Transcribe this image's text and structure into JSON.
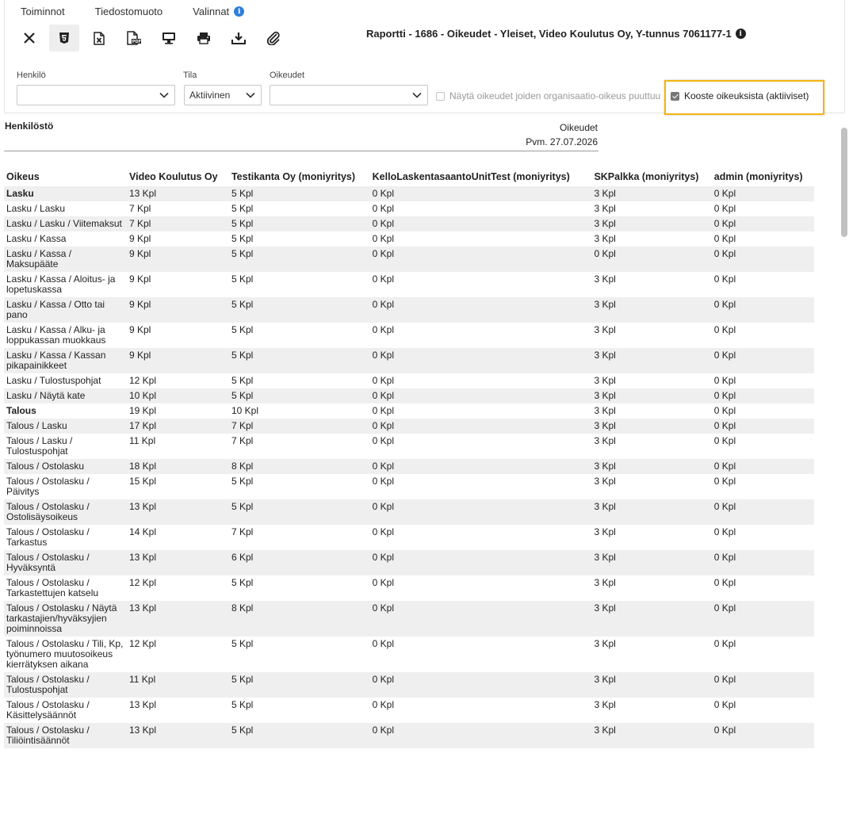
{
  "menu": {
    "items": [
      "Toiminnot",
      "Tiedostomuoto",
      "Valinnat"
    ]
  },
  "toolbar": {
    "buttons": [
      "close-icon",
      "html5-icon",
      "excel-icon",
      "pdf-icon",
      "screen-icon",
      "print-icon",
      "download-icon",
      "attachment-icon"
    ]
  },
  "report": {
    "title": "Raportti - 1686 - Oikeudet - Yleiset, Video Koulutus Oy, Y-tunnus 7061177-1",
    "section": "Henkilöstö",
    "kind": "Oikeudet",
    "date": "Pvm. 27.07.2026"
  },
  "filters": {
    "person_label": "Henkilö",
    "person_value": "",
    "status_label": "Tila",
    "status_value": "Aktiivinen",
    "rights_label": "Oikeudet",
    "rights_value": "",
    "show_org_label": "Näytä oikeudet joiden organisaatio-oikeus puuttuu",
    "show_org_checked": false,
    "summary_label": "Kooste oikeuksista (aktiiviset)",
    "summary_checked": true
  },
  "colors": {
    "highlight": "#f3b50f",
    "info": "#2f7fd8",
    "stripe": "#efefef"
  },
  "table": {
    "headers": [
      "Oikeus",
      "Video Koulutus Oy",
      "Testikanta Oy (moniyritys)",
      "KelloLaskentasaantoUnitTest (moniyritys)",
      "SKPalkka (moniyritys)",
      "admin (moniyritys)"
    ],
    "rows": [
      {
        "bold": true,
        "cells": [
          "Lasku",
          "13 Kpl",
          "5 Kpl",
          "0 Kpl",
          "3 Kpl",
          "0 Kpl"
        ]
      },
      {
        "bold": false,
        "cells": [
          "Lasku / Lasku",
          "7 Kpl",
          "5 Kpl",
          "0 Kpl",
          "3 Kpl",
          "0 Kpl"
        ]
      },
      {
        "bold": false,
        "cells": [
          "Lasku / Lasku / Viitemaksut",
          "7 Kpl",
          "5 Kpl",
          "0 Kpl",
          "3 Kpl",
          "0 Kpl"
        ]
      },
      {
        "bold": false,
        "cells": [
          "Lasku / Kassa",
          "9 Kpl",
          "5 Kpl",
          "0 Kpl",
          "3 Kpl",
          "0 Kpl"
        ]
      },
      {
        "bold": false,
        "cells": [
          "Lasku / Kassa / Maksupääte",
          "9 Kpl",
          "5 Kpl",
          "0 Kpl",
          "0 Kpl",
          "0 Kpl"
        ]
      },
      {
        "bold": false,
        "cells": [
          "Lasku / Kassa / Aloitus- ja lopetuskassa",
          "9 Kpl",
          "5 Kpl",
          "0 Kpl",
          "3 Kpl",
          "0 Kpl"
        ]
      },
      {
        "bold": false,
        "cells": [
          "Lasku / Kassa / Otto tai pano",
          "9 Kpl",
          "5 Kpl",
          "0 Kpl",
          "3 Kpl",
          "0 Kpl"
        ]
      },
      {
        "bold": false,
        "cells": [
          "Lasku / Kassa / Alku- ja loppukassan muokkaus",
          "9 Kpl",
          "5 Kpl",
          "0 Kpl",
          "3 Kpl",
          "0 Kpl"
        ]
      },
      {
        "bold": false,
        "cells": [
          "Lasku / Kassa / Kassan pikapainikkeet",
          "9 Kpl",
          "5 Kpl",
          "0 Kpl",
          "3 Kpl",
          "0 Kpl"
        ]
      },
      {
        "bold": false,
        "cells": [
          "Lasku / Tulostuspohjat",
          "12 Kpl",
          "5 Kpl",
          "0 Kpl",
          "3 Kpl",
          "0 Kpl"
        ]
      },
      {
        "bold": false,
        "cells": [
          "Lasku / Näytä kate",
          "10 Kpl",
          "5 Kpl",
          "0 Kpl",
          "3 Kpl",
          "0 Kpl"
        ]
      },
      {
        "bold": true,
        "cells": [
          "Talous",
          "19 Kpl",
          "10 Kpl",
          "0 Kpl",
          "3 Kpl",
          "0 Kpl"
        ]
      },
      {
        "bold": false,
        "cells": [
          "Talous / Lasku",
          "17 Kpl",
          "7 Kpl",
          "0 Kpl",
          "3 Kpl",
          "0 Kpl"
        ]
      },
      {
        "bold": false,
        "cells": [
          "Talous / Lasku / Tulostuspohjat",
          "11 Kpl",
          "7 Kpl",
          "0 Kpl",
          "3 Kpl",
          "0 Kpl"
        ]
      },
      {
        "bold": false,
        "cells": [
          "Talous / Ostolasku",
          "18 Kpl",
          "8 Kpl",
          "0 Kpl",
          "3 Kpl",
          "0 Kpl"
        ]
      },
      {
        "bold": false,
        "cells": [
          "Talous / Ostolasku / Päivitys",
          "15 Kpl",
          "5 Kpl",
          "0 Kpl",
          "3 Kpl",
          "0 Kpl"
        ]
      },
      {
        "bold": false,
        "cells": [
          "Talous / Ostolasku / Ostolisäysoikeus",
          "13 Kpl",
          "5 Kpl",
          "0 Kpl",
          "3 Kpl",
          "0 Kpl"
        ]
      },
      {
        "bold": false,
        "cells": [
          "Talous / Ostolasku / Tarkastus",
          "14 Kpl",
          "7 Kpl",
          "0 Kpl",
          "3 Kpl",
          "0 Kpl"
        ]
      },
      {
        "bold": false,
        "cells": [
          "Talous / Ostolasku / Hyväksyntä",
          "13 Kpl",
          "6 Kpl",
          "0 Kpl",
          "3 Kpl",
          "0 Kpl"
        ]
      },
      {
        "bold": false,
        "cells": [
          "Talous / Ostolasku / Tarkastettujen katselu",
          "12 Kpl",
          "5 Kpl",
          "0 Kpl",
          "3 Kpl",
          "0 Kpl"
        ]
      },
      {
        "bold": false,
        "cells": [
          "Talous / Ostolasku / Näytä tarkastajien/hyväksyjien poiminnoissa",
          "13 Kpl",
          "8 Kpl",
          "0 Kpl",
          "3 Kpl",
          "0 Kpl"
        ]
      },
      {
        "bold": false,
        "cells": [
          "Talous / Ostolasku / Tili, Kp, työnumero muutosoikeus kierrätyksen aikana",
          "12 Kpl",
          "5 Kpl",
          "0 Kpl",
          "3 Kpl",
          "0 Kpl"
        ]
      },
      {
        "bold": false,
        "cells": [
          "Talous / Ostolasku / Tulostuspohjat",
          "11 Kpl",
          "5 Kpl",
          "0 Kpl",
          "3 Kpl",
          "0 Kpl"
        ]
      },
      {
        "bold": false,
        "cells": [
          "Talous / Ostolasku / Käsittelysäännöt",
          "13 Kpl",
          "5 Kpl",
          "0 Kpl",
          "3 Kpl",
          "0 Kpl"
        ]
      },
      {
        "bold": false,
        "cells": [
          "Talous / Ostolasku / Tiliöintisäännöt",
          "13 Kpl",
          "5 Kpl",
          "0 Kpl",
          "3 Kpl",
          "0 Kpl"
        ]
      }
    ]
  }
}
